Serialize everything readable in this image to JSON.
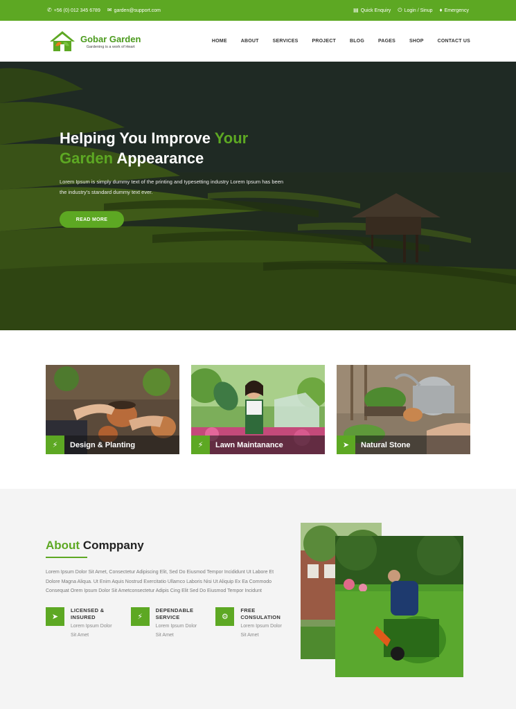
{
  "topbar": {
    "phone": "+56 (0) 012 345 6789",
    "email": "garden@support.com",
    "quick_enquiry": "Quick Enquiry",
    "login": "Login / Sinup",
    "emergency": "Emergency"
  },
  "brand": {
    "name": "Gobar Garden",
    "tagline": "Gardening is a work of Heart"
  },
  "nav": [
    "HOME",
    "ABOUT",
    "SERVICES",
    "PROJECT",
    "BLOG",
    "PAGES",
    "SHOP",
    "CONTACT US"
  ],
  "hero": {
    "title_part1": "Helping You Improve ",
    "title_green1": "Your",
    "title_green2": "Garden",
    "title_part2": " Appearance",
    "description": "Lorem Ipsum is simply dummy text of the printing and typesetting industry Lorem Ipsum has been the industry's standard dummy text ever.",
    "button": "READ MORE"
  },
  "services": [
    {
      "title": "Design & Planting",
      "icon": "bolt-icon"
    },
    {
      "title": "Lawn Maintanance",
      "icon": "bolt-icon"
    },
    {
      "title": "Natural Stone",
      "icon": "paper-plane-icon"
    }
  ],
  "about": {
    "title_green": "About",
    "title_rest": " Comppany",
    "description": "Lorem Ipsum Dolor Sit Amet, Consectetur Adipiscing Elit, Sed Do Eiusmod Tempor Incididunt Ut Labore Et Dolore Magna Aliqua. Ut Enim Aquis Nostrud Exercitatio Ullamco Laboris Nisi Ut Aliquip Ex Ea Commodo Consequat Orem Ipsum Dolor Sit Ametconsectetur Adipis Cing Elit Sed Do Eiusmod Tempor Incidunt",
    "features": [
      {
        "title_l1": "LICENSED &",
        "title_l2": "INSURED",
        "desc": "Lorem Ipsum Dolor Sit Amet",
        "icon": "paper-plane-icon"
      },
      {
        "title_l1": "DEPENDABLE",
        "title_l2": "SERVICE",
        "desc": "Lorem Ipsum Dolor Sit Amet",
        "icon": "bolt-icon"
      },
      {
        "title_l1": "FREE",
        "title_l2": "CONSULATION",
        "desc": "Lorem Ipsum Dolor Sit Amet",
        "icon": "gear-icon"
      }
    ]
  },
  "colors": {
    "accent": "#5da823",
    "topbar": "#5da823"
  }
}
